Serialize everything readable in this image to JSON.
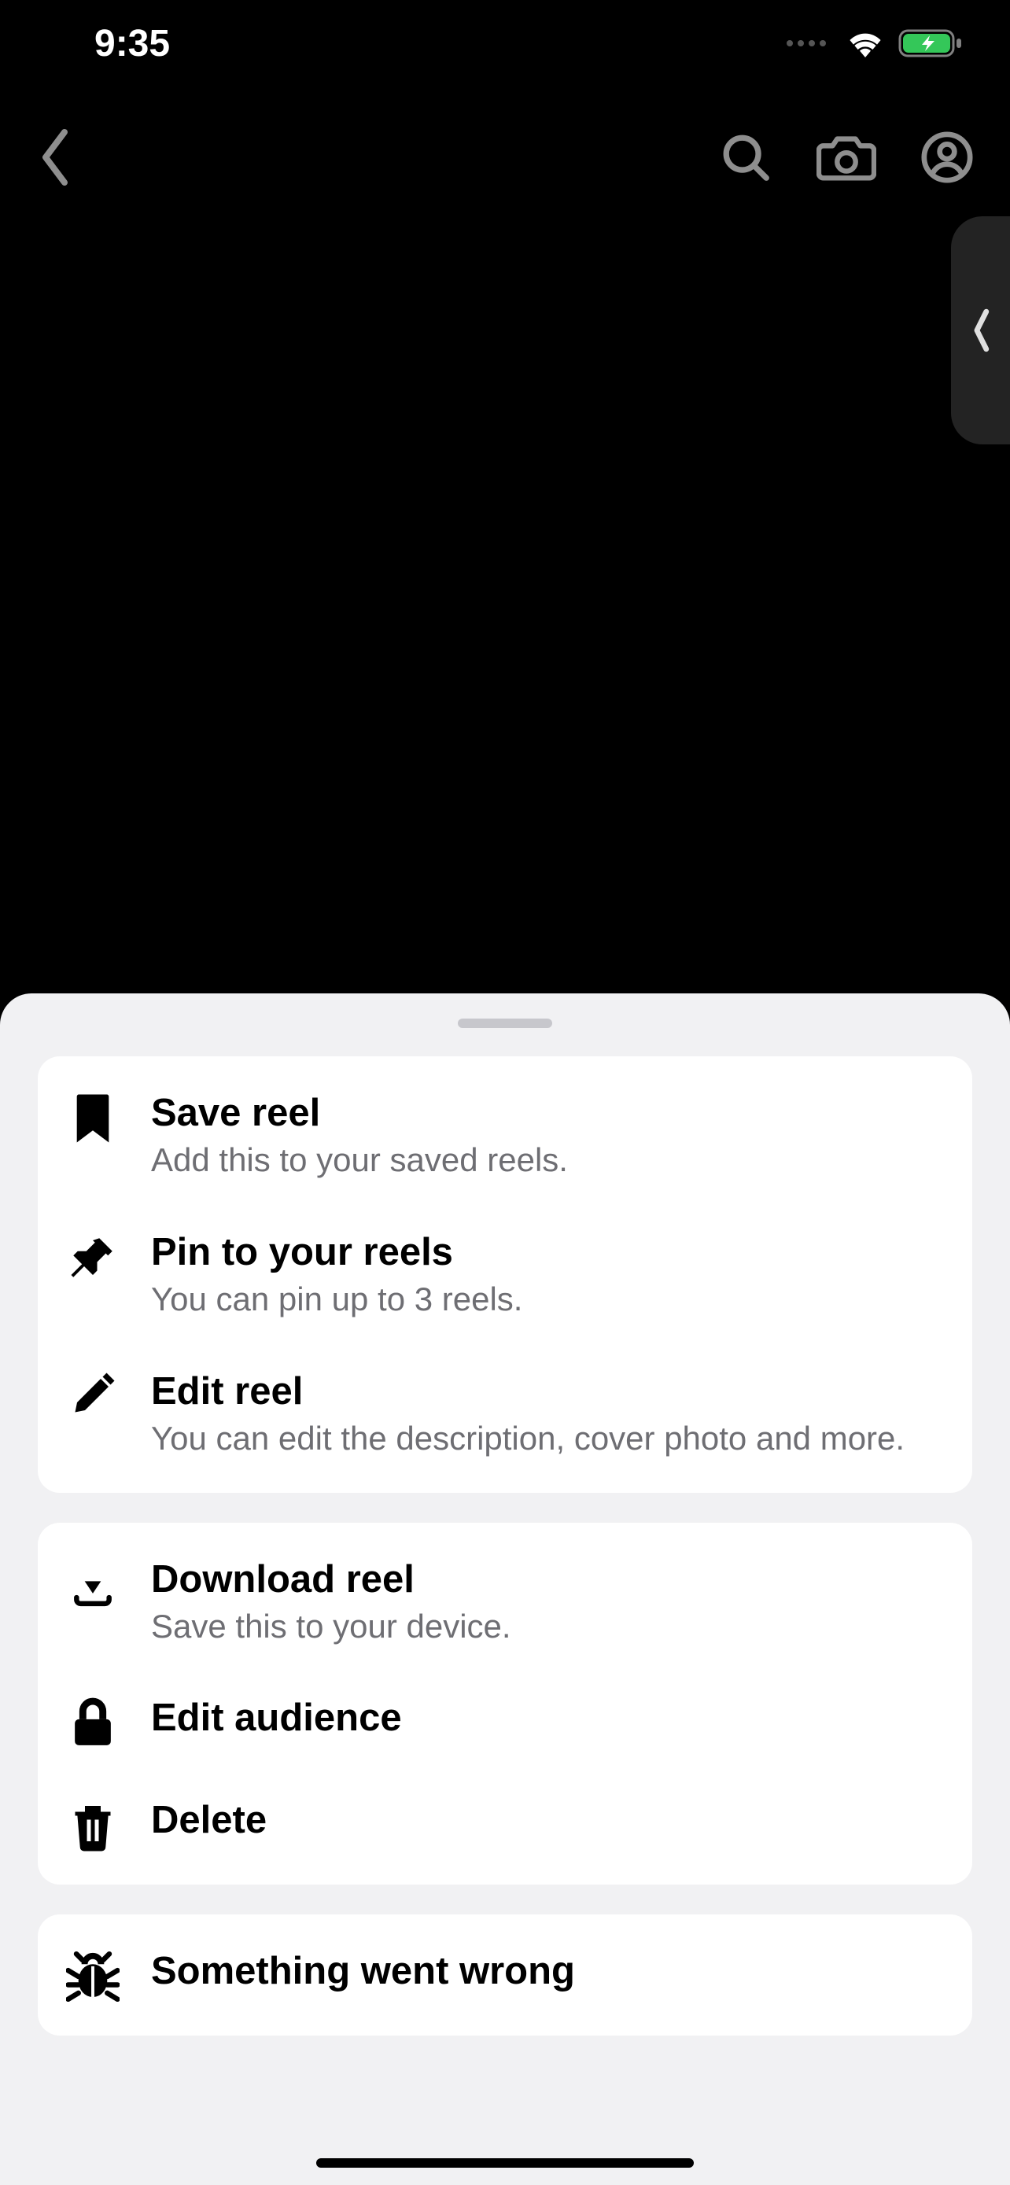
{
  "status": {
    "time": "9:35"
  },
  "sheet": {
    "group1": [
      {
        "icon": "bookmark-icon",
        "title": "Save reel",
        "sub": "Add this to your saved reels."
      },
      {
        "icon": "pin-icon",
        "title": "Pin to your reels",
        "sub": "You can pin up to 3 reels."
      },
      {
        "icon": "pencil-icon",
        "title": "Edit reel",
        "sub": "You can edit the description, cover photo and more."
      }
    ],
    "group2": [
      {
        "icon": "download-icon",
        "title": "Download reel",
        "sub": "Save this to your device."
      },
      {
        "icon": "lock-icon",
        "title": "Edit audience",
        "sub": ""
      },
      {
        "icon": "trash-icon",
        "title": "Delete",
        "sub": ""
      }
    ],
    "group3": [
      {
        "icon": "bug-icon",
        "title": "Something went wrong",
        "sub": ""
      }
    ]
  }
}
